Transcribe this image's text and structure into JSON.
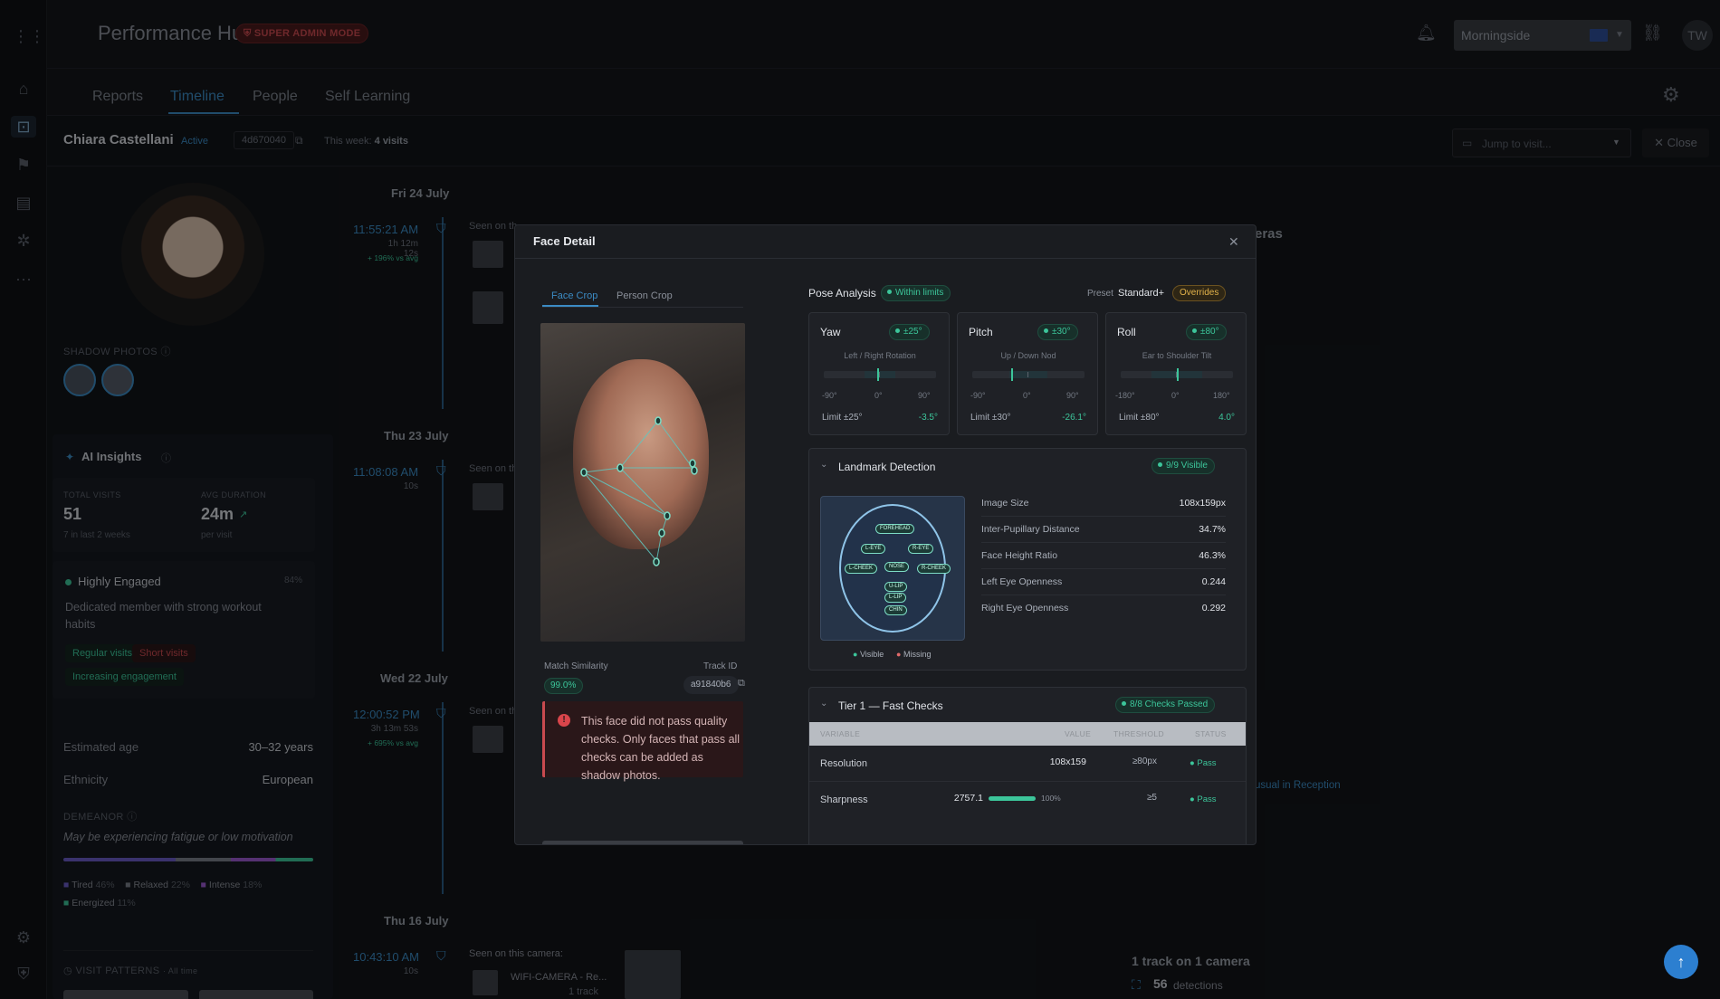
{
  "app": {
    "brand": "Performance Hub",
    "badge": "SUPER ADMIN MODE",
    "location": "Morningside",
    "user_initials": "TW"
  },
  "tabs": [
    "Reports",
    "Timeline",
    "People",
    "Self Learning"
  ],
  "person": {
    "name": "Chiara Castellani",
    "status": "Active",
    "id": "4d670040",
    "week_prefix": "This week:",
    "week_value": "4 visits",
    "jump_placeholder": "Jump to visit...",
    "close_label": "Close"
  },
  "left": {
    "shadow_photos_label": "SHADOW PHOTOS",
    "ai_insights_title": "AI Insights",
    "total_visits_label": "TOTAL VISITS",
    "total_visits": "51",
    "total_visits_sub": "7 in last 2 weeks",
    "avg_duration_label": "AVG DURATION",
    "avg_duration": "24m",
    "avg_duration_sub": "per visit",
    "engagement_title": "Highly Engaged",
    "engagement_pct": "84%",
    "engagement_desc": "Dedicated member with strong workout habits",
    "tags": [
      "Regular visits",
      "Short visits",
      "Increasing engagement"
    ],
    "estimated_age_label": "Estimated age",
    "estimated_age": "30–32 years",
    "ethnicity_label": "Ethnicity",
    "ethnicity": "European",
    "demeanor_label": "DEMEANOR",
    "demeanor_text": "May be experiencing fatigue or low motivation",
    "moods": [
      {
        "name": "Tired",
        "pct": "46%",
        "color": "#6a5cc7"
      },
      {
        "name": "Relaxed",
        "pct": "22%",
        "color": "#7a808a"
      },
      {
        "name": "Intense",
        "pct": "18%",
        "color": "#9b59d0"
      },
      {
        "name": "Energized",
        "pct": "11%",
        "color": "#3cc59a"
      }
    ],
    "visit_patterns_label": "VISIT PATTERNS",
    "visit_patterns_scope": "· All time"
  },
  "timeline": {
    "days": [
      "Fri 24 July",
      "Thu 23 July",
      "Wed 22 July",
      "Thu 16 July"
    ],
    "visits": [
      {
        "time": "11:55:21 AM",
        "duration": "1h 12m 12s",
        "delta": "+ 196% vs avg",
        "seen": "Seen on th"
      },
      {
        "time": "11:08:08 AM",
        "duration": "10s",
        "delta": "",
        "seen": "Seen on th"
      },
      {
        "time": "12:00:52 PM",
        "duration": "3h 13m 53s",
        "delta": "+ 695% vs avg",
        "seen": "Seen on th"
      },
      {
        "time": "10:43:10 AM",
        "duration": "10s",
        "delta": "",
        "seen": "Seen on this camera:"
      }
    ],
    "camera_name": "WIFI-CAMERA - Re...",
    "camera_tracks": "1 track",
    "right_heading_fragment": "eras",
    "right_link_fragment": "usual in Reception",
    "tracks_summary": "1 track on 1 camera",
    "detections_count": "56",
    "detections_label": "detections"
  },
  "modal": {
    "title": "Face Detail",
    "crop_tabs": [
      "Face Crop",
      "Person Crop"
    ],
    "match_similarity_label": "Match Similarity",
    "match_similarity": "99.0%",
    "track_id_label": "Track ID",
    "track_id": "a91840b6",
    "error_text": "This face did not pass quality checks. Only faces that pass all checks can be added as shadow photos.",
    "pose_title": "Pose Analysis",
    "pose_status": "Within limits",
    "preset_label": "Preset",
    "preset_value": "Standard+",
    "overrides": "Overrides",
    "pose": [
      {
        "name": "Yaw",
        "limit_pill": "±25°",
        "desc": "Left / Right Rotation",
        "ticks": [
          "-90°",
          "0°",
          "90°"
        ],
        "limit": "Limit ±25°",
        "value": "-3.5°",
        "value_num": -3.5,
        "range": 90
      },
      {
        "name": "Pitch",
        "limit_pill": "±30°",
        "desc": "Up / Down Nod",
        "ticks": [
          "-90°",
          "0°",
          "90°"
        ],
        "limit": "Limit ±30°",
        "value": "-26.1°",
        "value_num": -26.1,
        "range": 90
      },
      {
        "name": "Roll",
        "limit_pill": "±80°",
        "desc": "Ear to Shoulder Tilt",
        "ticks": [
          "-180°",
          "0°",
          "180°"
        ],
        "limit": "Limit ±80°",
        "value": "4.0°",
        "value_num": 4.0,
        "range": 180
      }
    ],
    "landmark_title": "Landmark Detection",
    "landmark_status": "9/9 Visible",
    "landmarks": [
      "FOREHEAD",
      "L-EYE",
      "R-EYE",
      "L-CHEEK",
      "NOSE",
      "R-CHEEK",
      "U-LIP",
      "L-LIP",
      "CHIN"
    ],
    "legend_visible": "Visible",
    "legend_missing": "Missing",
    "metrics": [
      {
        "label": "Image Size",
        "value": "108x159px"
      },
      {
        "label": "Inter-Pupillary Distance",
        "value": "34.7%"
      },
      {
        "label": "Face Height Ratio",
        "value": "46.3%"
      },
      {
        "label": "Left Eye Openness",
        "value": "0.244"
      },
      {
        "label": "Right Eye Openness",
        "value": "0.292"
      }
    ],
    "tier_title": "Tier 1 — Fast Checks",
    "tier_status": "8/8 Checks Passed",
    "tier_headers": [
      "VARIABLE",
      "VALUE",
      "THRESHOLD",
      "STATUS"
    ],
    "checks": [
      {
        "variable": "Resolution",
        "value": "108x159",
        "threshold": "≥80px",
        "status": "Pass"
      },
      {
        "variable": "Sharpness",
        "value": "2757.1",
        "bar_pct": "100%",
        "bar_fill": 1.0,
        "threshold": "≥5",
        "status": "Pass"
      }
    ]
  }
}
